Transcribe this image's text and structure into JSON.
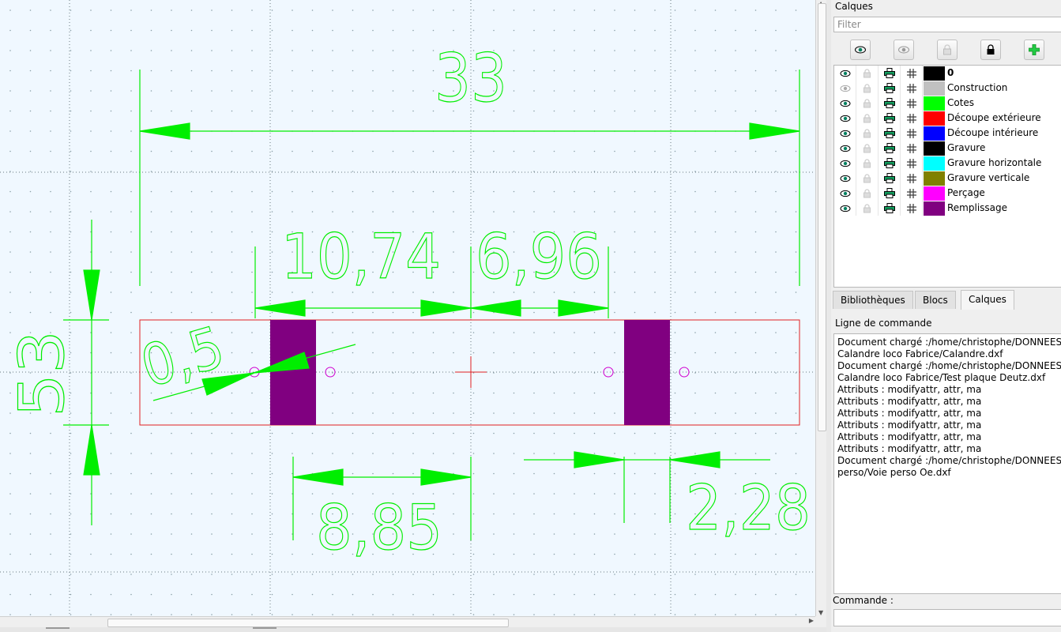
{
  "drawing": {
    "dimensions": {
      "top_width": "33",
      "left_height": "53",
      "segment_a": "10,74",
      "segment_b": "6,96",
      "radius": "0,5",
      "bottom_a": "8,85",
      "bottom_b": "2,28"
    }
  },
  "layers_panel": {
    "title": "Calques",
    "filter_placeholder": "Filter",
    "toolbar": [
      "show-all",
      "hide-all",
      "unlock-all",
      "lock-all",
      "add-layer"
    ],
    "layers": [
      {
        "name": "0",
        "color": "#000000",
        "visible": true,
        "bold": true
      },
      {
        "name": "Construction",
        "color": "#c0c0c0",
        "visible": false,
        "bold": false
      },
      {
        "name": "Cotes",
        "color": "#00ff00",
        "visible": true,
        "bold": false
      },
      {
        "name": "Découpe extérieure",
        "color": "#ff0000",
        "visible": true,
        "bold": false
      },
      {
        "name": "Découpe intérieure",
        "color": "#0000ff",
        "visible": true,
        "bold": false
      },
      {
        "name": "Gravure",
        "color": "#000000",
        "visible": true,
        "bold": false
      },
      {
        "name": "Gravure horizontale",
        "color": "#00ffff",
        "visible": true,
        "bold": false
      },
      {
        "name": "Gravure verticale",
        "color": "#808000",
        "visible": true,
        "bold": false
      },
      {
        "name": "Perçage",
        "color": "#ff00ff",
        "visible": true,
        "bold": false
      },
      {
        "name": "Remplissage",
        "color": "#800080",
        "visible": true,
        "bold": false
      }
    ]
  },
  "tabs": [
    {
      "label": "Bibliothèques",
      "active": false
    },
    {
      "label": "Blocs",
      "active": false
    },
    {
      "label": "Calques",
      "active": true
    }
  ],
  "command_line": {
    "title": "Ligne de commande",
    "log": [
      "Document chargé :/home/christophe/DONNEES",
      "Calandre loco Fabrice/Calandre.dxf",
      "Document chargé :/home/christophe/DONNEES",
      "Calandre loco Fabrice/Test plaque Deutz.dxf",
      "Attributs : modifyattr, attr, ma",
      "Attributs : modifyattr, attr, ma",
      "Attributs : modifyattr, attr, ma",
      "Attributs : modifyattr, attr, ma",
      "Attributs : modifyattr, attr, ma",
      "Attributs : modifyattr, attr, ma",
      "Document chargé :/home/christophe/DONNEES",
      "perso/Voie perso Oe.dxf"
    ],
    "input_label": "Commande :",
    "input_value": ""
  }
}
